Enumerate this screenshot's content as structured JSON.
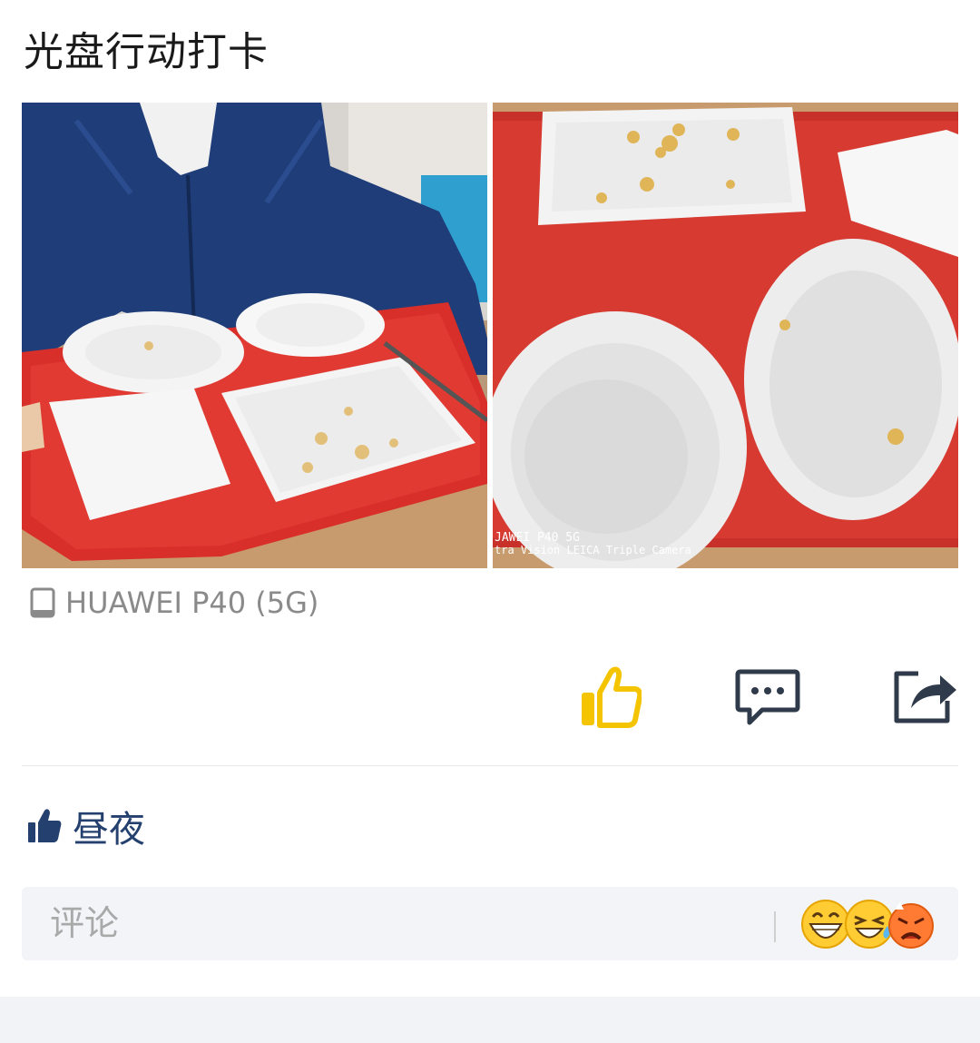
{
  "post": {
    "title": "光盘行动打卡",
    "device": "HUAWEI P40 (5G)",
    "photos": [
      {
        "icon": "photo-trays-person"
      },
      {
        "icon": "photo-empty-plates"
      }
    ],
    "photo_watermark": [
      "JAWEI P40 5G",
      "tra Vision LEICA Triple Camera"
    ]
  },
  "actions": {
    "like_icon": "thumbs-up-icon",
    "comment_icon": "comment-icon",
    "share_icon": "share-icon",
    "like_color": "#f5c400"
  },
  "likes": {
    "icon": "thumbs-up-filled-icon",
    "names": "昼夜",
    "color": "#24406e"
  },
  "comment": {
    "placeholder": "评论",
    "emojis": [
      "grinning-emoji",
      "laughing-tears-emoji",
      "angry-emoji"
    ]
  }
}
